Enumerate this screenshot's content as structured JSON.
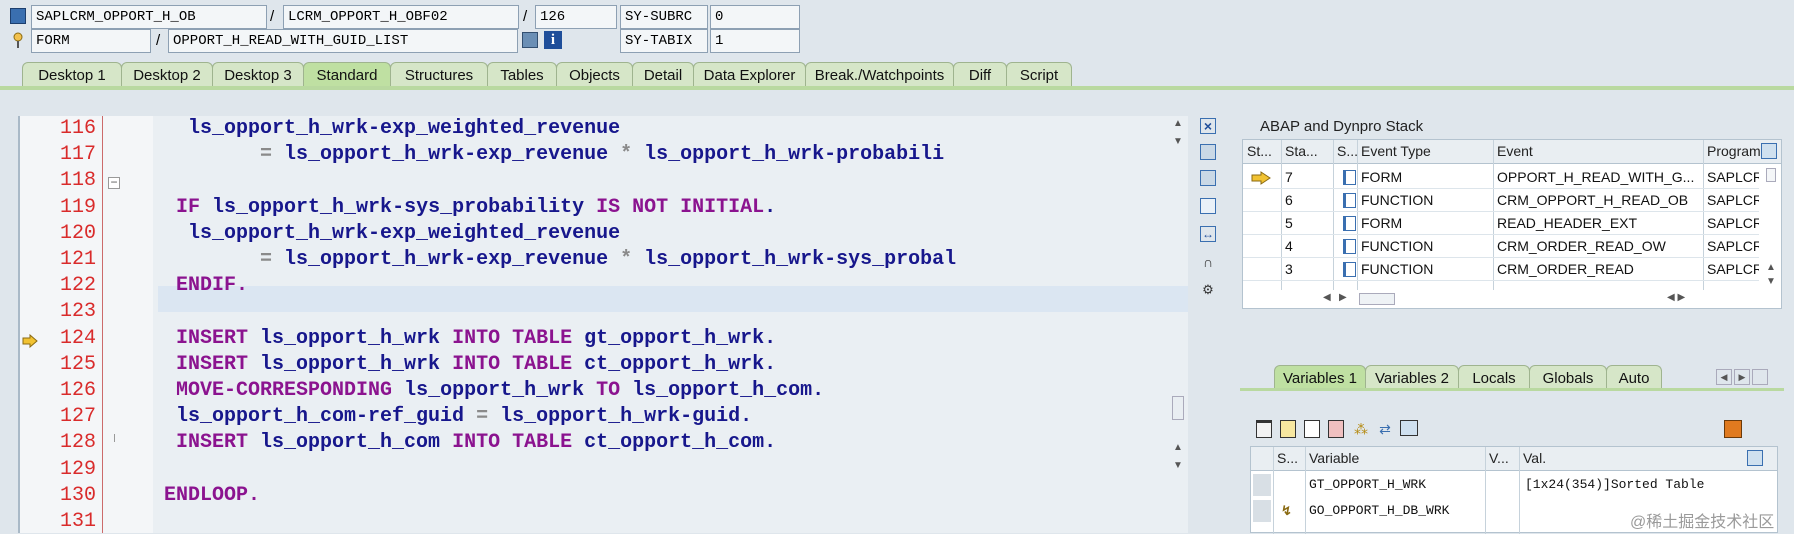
{
  "header": {
    "program": "SAPLCRM_OPPORT_H_OB",
    "include": "LCRM_OPPORT_H_OBF02",
    "line": "126",
    "sysubrc_label": "SY-SUBRC",
    "sysubrc_value": "0",
    "event_type": "FORM",
    "event": "OPPORT_H_READ_WITH_GUID_LIST",
    "sytabix_label": "SY-TABIX",
    "sytabix_value": "1",
    "slash": "/"
  },
  "tabs": [
    "Desktop 1",
    "Desktop 2",
    "Desktop 3",
    "Standard",
    "Structures",
    "Tables",
    "Objects",
    "Detail",
    "Data Explorer",
    "Break./Watchpoints",
    "Diff",
    "Script"
  ],
  "code": {
    "lines": [
      {
        "n": "116",
        "parts": [
          {
            "t": "    ls_opport_h_wrk-exp_weighted_revenue",
            "c": "id"
          }
        ]
      },
      {
        "n": "117",
        "parts": [
          {
            "t": "          ",
            "c": "id"
          },
          {
            "t": "=",
            "c": "op"
          },
          {
            "t": " ls_opport_h_wrk-exp_revenue ",
            "c": "id"
          },
          {
            "t": "*",
            "c": "op"
          },
          {
            "t": " ls_opport_h_wrk-probabili",
            "c": "id"
          }
        ]
      },
      {
        "n": "118",
        "parts": []
      },
      {
        "n": "119",
        "parts": [
          {
            "t": "   ",
            "c": "id"
          },
          {
            "t": "IF",
            "c": "kw"
          },
          {
            "t": " ls_opport_h_wrk-sys_probability ",
            "c": "id"
          },
          {
            "t": "IS NOT INITIAL",
            "c": "kw"
          },
          {
            "t": ".",
            "c": "id"
          }
        ]
      },
      {
        "n": "120",
        "parts": [
          {
            "t": "    ls_opport_h_wrk-exp_weighted_revenue",
            "c": "id"
          }
        ]
      },
      {
        "n": "121",
        "parts": [
          {
            "t": "          ",
            "c": "id"
          },
          {
            "t": "=",
            "c": "op"
          },
          {
            "t": " ls_opport_h_wrk-exp_revenue ",
            "c": "id"
          },
          {
            "t": "*",
            "c": "op"
          },
          {
            "t": " ls_opport_h_wrk-sys_probal",
            "c": "id"
          }
        ]
      },
      {
        "n": "122",
        "parts": [
          {
            "t": "   ",
            "c": "id"
          },
          {
            "t": "ENDIF.",
            "c": "kw"
          }
        ]
      },
      {
        "n": "123",
        "parts": []
      },
      {
        "n": "124",
        "parts": [
          {
            "t": "   ",
            "c": "id"
          },
          {
            "t": "INSERT",
            "c": "kw"
          },
          {
            "t": " ls_opport_h_wrk ",
            "c": "id"
          },
          {
            "t": "INTO TABLE",
            "c": "kw"
          },
          {
            "t": " gt_opport_h_wrk.",
            "c": "id"
          }
        ]
      },
      {
        "n": "125",
        "parts": [
          {
            "t": "   ",
            "c": "id"
          },
          {
            "t": "INSERT",
            "c": "kw"
          },
          {
            "t": " ls_opport_h_wrk ",
            "c": "id"
          },
          {
            "t": "INTO TABLE",
            "c": "kw"
          },
          {
            "t": " ct_opport_h_wrk.",
            "c": "id"
          }
        ]
      },
      {
        "n": "126",
        "parts": [
          {
            "t": "   ",
            "c": "id"
          },
          {
            "t": "MOVE-CORRESPONDING",
            "c": "kw"
          },
          {
            "t": " ls_opport_h_wrk ",
            "c": "id"
          },
          {
            "t": "TO",
            "c": "kw"
          },
          {
            "t": " ls_opport_h_com.",
            "c": "id"
          }
        ]
      },
      {
        "n": "127",
        "parts": [
          {
            "t": "   ls_opport_h_com-ref_guid ",
            "c": "id"
          },
          {
            "t": "=",
            "c": "op"
          },
          {
            "t": " ls_opport_h_wrk-guid.",
            "c": "id"
          }
        ]
      },
      {
        "n": "128",
        "parts": [
          {
            "t": "   ",
            "c": "id"
          },
          {
            "t": "INSERT",
            "c": "kw"
          },
          {
            "t": " ls_opport_h_com ",
            "c": "id"
          },
          {
            "t": "INTO TABLE",
            "c": "kw"
          },
          {
            "t": " ct_opport_h_com.",
            "c": "id"
          }
        ]
      },
      {
        "n": "129",
        "parts": []
      },
      {
        "n": "130",
        "parts": [
          {
            "t": "  ",
            "c": "id"
          },
          {
            "t": "ENDLOOP.",
            "c": "kw"
          }
        ]
      },
      {
        "n": "131",
        "parts": []
      }
    ]
  },
  "stack": {
    "title": "ABAP and Dynpro Stack",
    "columns": [
      "St...",
      "Sta...",
      "S...",
      "Event Type",
      "Event",
      "Program"
    ],
    "rows": [
      {
        "level": "7",
        "type": "FORM",
        "event": "OPPORT_H_READ_WITH_G...",
        "program": "SAPLCRI"
      },
      {
        "level": "6",
        "type": "FUNCTION",
        "event": "CRM_OPPORT_H_READ_OB",
        "program": "SAPLCRI"
      },
      {
        "level": "5",
        "type": "FORM",
        "event": "READ_HEADER_EXT",
        "program": "SAPLCRI"
      },
      {
        "level": "4",
        "type": "FUNCTION",
        "event": "CRM_ORDER_READ_OW",
        "program": "SAPLCRI"
      },
      {
        "level": "3",
        "type": "FUNCTION",
        "event": "CRM_ORDER_READ",
        "program": "SAPLCRI"
      }
    ]
  },
  "vartabs": [
    "Variables 1",
    "Variables 2",
    "Locals",
    "Globals",
    "Auto"
  ],
  "vars": {
    "columns": [
      "S...",
      "Variable",
      "V...",
      "Val."
    ],
    "rows": [
      {
        "name": "GT_OPPORT_H_WRK",
        "value": "[1x24(354)]Sorted Table"
      },
      {
        "name": "GO_OPPORT_H_DB_WRK",
        "value": ""
      }
    ]
  },
  "watermark": "@稀土掘金技术社区",
  "colors": {
    "keyword": "#8b138f",
    "identifier": "#17178c",
    "line_number": "#d92b2b",
    "tab_active": "#bfe0a2"
  }
}
